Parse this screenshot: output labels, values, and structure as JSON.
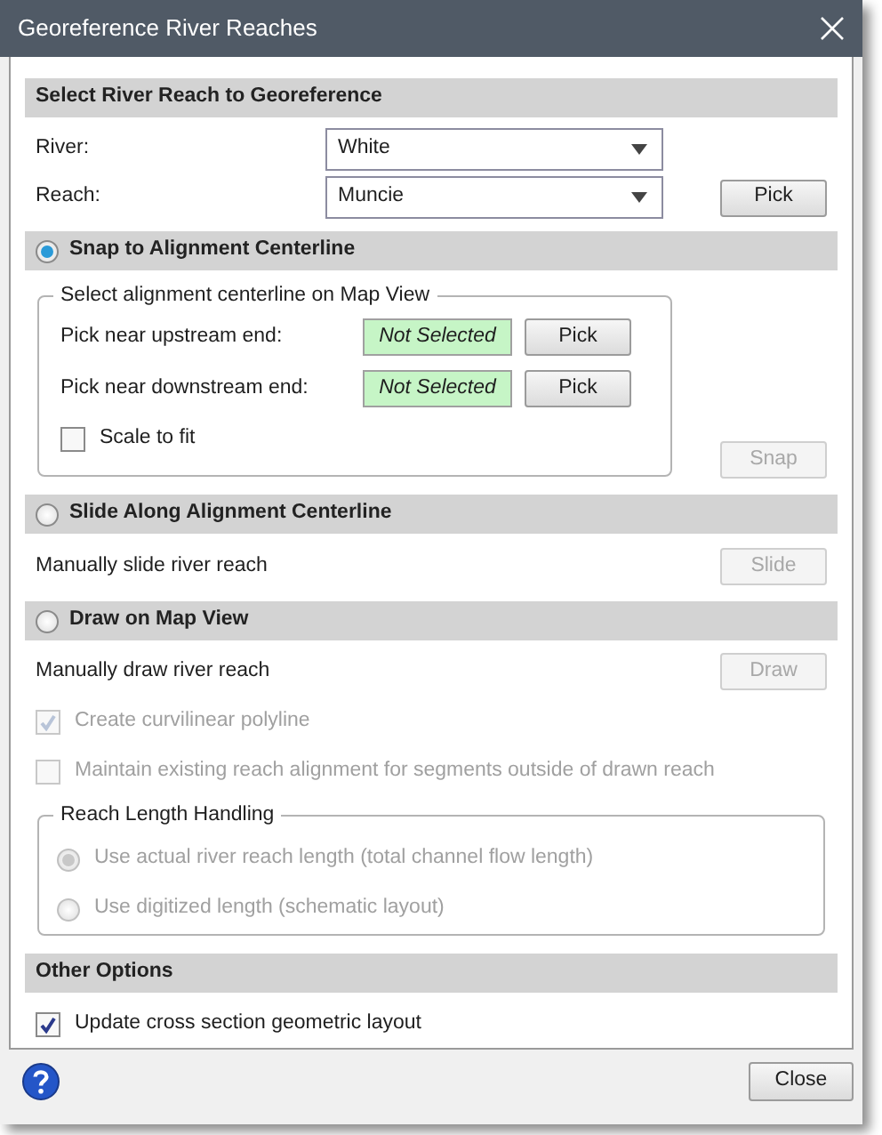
{
  "window": {
    "title": "Georeference River Reaches"
  },
  "select_reach": {
    "header": "Select River Reach to Georeference",
    "fields": [
      {
        "label": "River:",
        "value": "White"
      },
      {
        "label": "Reach:",
        "value": "Muncie"
      }
    ],
    "pick_button": {
      "label": "Pick",
      "disabled": false
    }
  },
  "modes": [
    {
      "kind": "snap",
      "label": "Snap to Alignment Centerline",
      "selected": true,
      "group": {
        "legend": "Select alignment centerline on Map View",
        "rows": [
          {
            "label": "Pick near upstream end:",
            "status": "Not Selected",
            "button": "Pick"
          },
          {
            "label": "Pick near downstream end:",
            "status": "Not Selected",
            "button": "Pick"
          }
        ],
        "checkbox": {
          "label": "Scale to fit",
          "checked": false,
          "disabled": false
        }
      },
      "button": {
        "label": "Snap",
        "disabled": true
      }
    },
    {
      "kind": "slide",
      "label": "Slide Along Alignment Centerline",
      "selected": false,
      "description": "Manually slide river reach",
      "button": {
        "label": "Slide",
        "disabled": true
      }
    },
    {
      "kind": "draw",
      "label": "Draw on Map View",
      "selected": false,
      "description": "Manually draw river reach",
      "button": {
        "label": "Draw",
        "disabled": true
      },
      "options": [
        {
          "label": "Create curvilinear polyline",
          "checked": true,
          "disabled": true
        },
        {
          "label": "Maintain existing reach alignment for segments outside of drawn reach",
          "checked": false,
          "disabled": true
        }
      ],
      "length_group": {
        "legend": "Reach Length Handling",
        "options": [
          {
            "label": "Use actual river reach length (total channel flow length)",
            "selected": true,
            "disabled": true
          },
          {
            "label": "Use digitized length (schematic layout)",
            "selected": false,
            "disabled": true
          }
        ]
      }
    }
  ],
  "other_options": {
    "header": "Other Options",
    "options": [
      {
        "label": "Update cross section geometric layout",
        "checked": true,
        "disabled": false
      }
    ]
  },
  "footer": {
    "close_button": "Close"
  }
}
